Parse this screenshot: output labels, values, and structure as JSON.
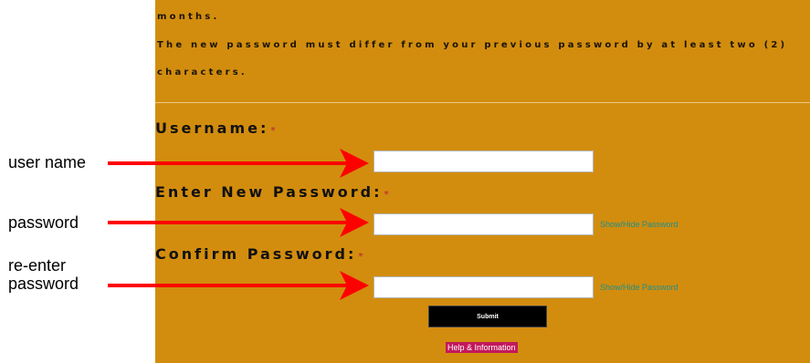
{
  "policy_text": {
    "line1": "months.",
    "line2": "The new password must differ from your previous password by at least two (2)",
    "line3": "characters."
  },
  "form": {
    "username_label": "Username:",
    "new_password_label": "Enter New Password:",
    "confirm_password_label": "Confirm Password:",
    "required_mark": "*",
    "username_value": "",
    "new_password_value": "",
    "confirm_password_value": "",
    "show_hide_label_1": "Show/Hide Password",
    "show_hide_label_2": "Show/Hide Password",
    "submit_label": "Submit",
    "help_label": "Help & Information"
  },
  "annotations": {
    "user_name": "user name",
    "password": "password",
    "reenter_line1": "re-enter",
    "reenter_line2": "password"
  },
  "colors": {
    "panel": "#d28d0e",
    "arrow": "#ff0000",
    "link": "#1e8f8c",
    "help_bg": "#c2185b"
  }
}
